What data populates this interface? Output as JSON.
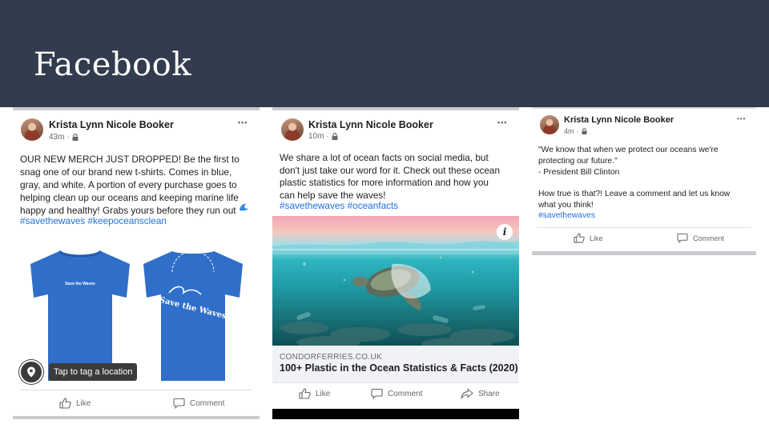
{
  "slide": {
    "title": "Facebook"
  },
  "posts": [
    {
      "author": "Krista Lynn Nicole Booker",
      "time": "43m",
      "dot": "·",
      "more": "•••",
      "text": "OUR NEW MERCH JUST DROPPED! Be the first to\nsnag one of our brand new t-shirts. Comes in blue,\ngray, and white. A portion of every purchase goes to\nhelping clean up our oceans and keeping marine life\nhappy and healthy! Grabs yours before they run out",
      "hashtags": "#savethewaves #keepoceansclean",
      "shirt_front_text": "Save the Waves",
      "shirt_back_text": "Save the Waves",
      "tag_tooltip": "Tap to tag a location",
      "actions": {
        "like": "Like",
        "comment": "Comment"
      }
    },
    {
      "author": "Krista Lynn Nicole Booker",
      "time": "10m",
      "dot": "·",
      "more": "•••",
      "text": "We share a lot of ocean facts on social media, but\ndon't just take our word for it. Check out these ocean\nplastic statistics for more information and how you\ncan help save the waves!",
      "hashtags": "#savethewaves #oceanfacts",
      "info": "i",
      "link": {
        "domain": "CONDORFERRIES.CO.UK",
        "title": "100+ Plastic in the Ocean Statistics & Facts (2020)"
      },
      "actions": {
        "like": "Like",
        "comment": "Comment",
        "share": "Share"
      }
    },
    {
      "author": "Krista Lynn Nicole Booker",
      "time": "4m",
      "dot": "·",
      "more": "•••",
      "text": "\"We know that when we protect our oceans we're\nprotecting our future.\"\n- President Bill Clinton\n\nHow true is that?! Leave a comment and let us know\nwhat you think!",
      "hashtags": "#savethewaves",
      "actions": {
        "like": "Like",
        "comment": "Comment"
      }
    }
  ],
  "colors": {
    "header_bg": "#323c4e",
    "hashtag": "#216fdb",
    "shirt_blue": "#2f6fc9"
  },
  "icons": [
    "lock-icon",
    "more-icon",
    "wave-emoji-icon",
    "location-pin-icon",
    "like-icon",
    "comment-icon",
    "share-icon",
    "info-icon"
  ]
}
